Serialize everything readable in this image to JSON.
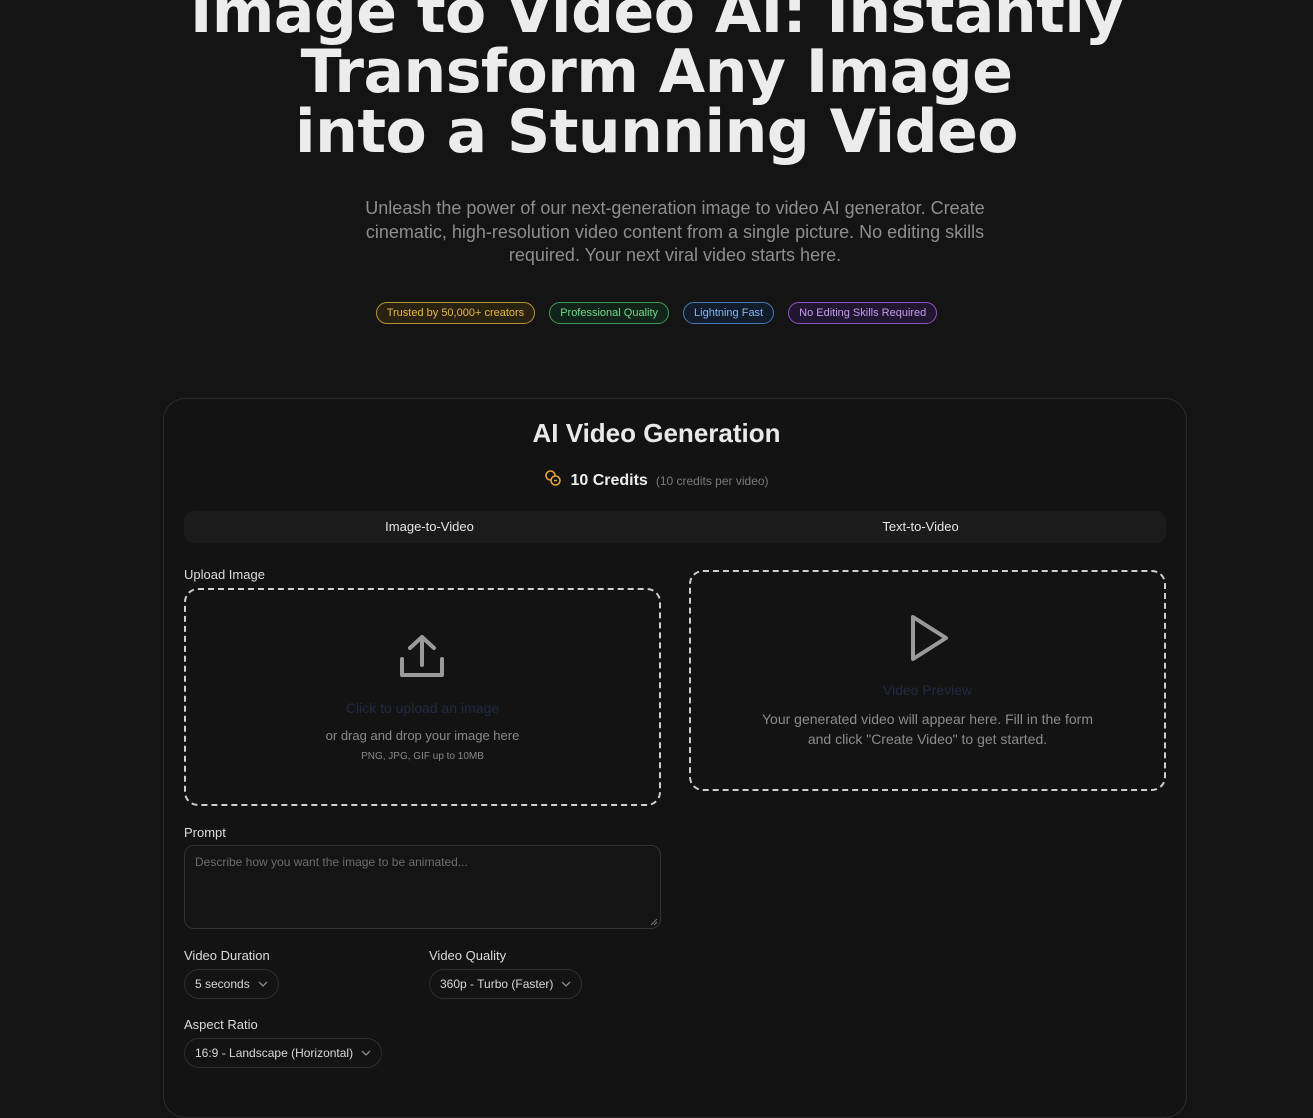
{
  "hero": {
    "title_lines": [
      "Image to Video AI: Instantly",
      "Transform Any Image",
      "into a Stunning Video"
    ],
    "subtitle": "Unleash the power of our next-generation image to video AI generator. Create cinematic, high-resolution video content from a single picture. No editing skills required. Your next viral video starts here."
  },
  "badges": [
    {
      "label": "Trusted by 50,000+ creators",
      "color": "#e8b84a"
    },
    {
      "label": "Professional Quality",
      "color": "#5fcf7d"
    },
    {
      "label": "Lightning Fast",
      "color": "#6aa6ea"
    },
    {
      "label": "No Editing Skills Required",
      "color": "#b07ce6"
    }
  ],
  "card": {
    "title": "AI Video Generation",
    "credits": {
      "amount": "10 Credits",
      "note": "(10 credits per video)",
      "icon": "coins-icon",
      "icon_color": "#e8a33a"
    },
    "tabs": [
      {
        "label": "Image-to-Video"
      },
      {
        "label": "Text-to-Video"
      }
    ],
    "upload": {
      "label": "Upload Image",
      "icon": "upload-icon",
      "link_text": "Click to upload an image",
      "hint": "or drag and drop your image here",
      "formats": "PNG, JPG, GIF up to 10MB"
    },
    "preview": {
      "icon": "play-icon",
      "title": "Video Preview",
      "description": "Your generated video will appear here. Fill in the form and click \"Create Video\" to get started."
    },
    "prompt": {
      "label": "Prompt",
      "placeholder": "Describe how you want the image to be animated..."
    },
    "duration": {
      "label": "Video Duration",
      "value": "5 seconds"
    },
    "quality": {
      "label": "Video Quality",
      "value": "360p - Turbo (Faster)"
    },
    "aspect": {
      "label": "Aspect Ratio",
      "value": "16:9 - Landscape (Horizontal)"
    }
  }
}
